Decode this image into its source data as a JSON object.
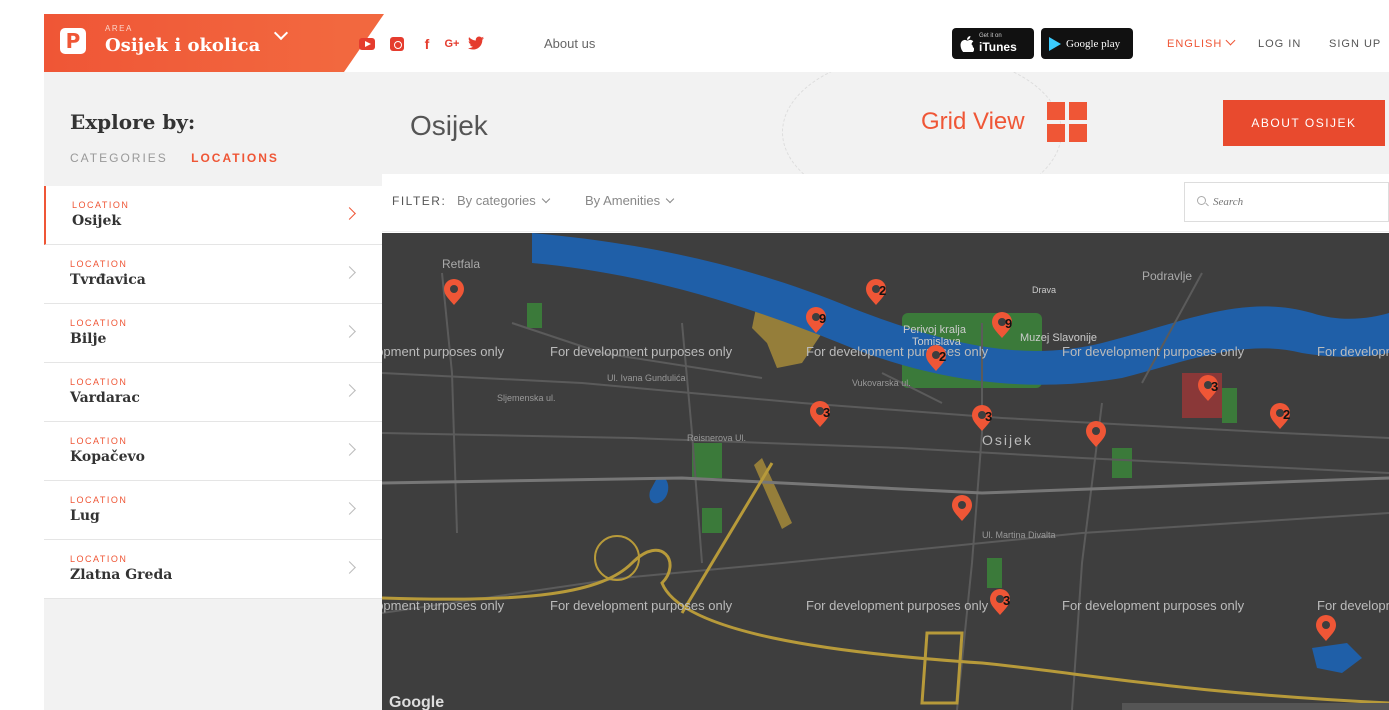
{
  "topbar": {
    "area_label": "AREA",
    "area_name": "Osijek i okolica",
    "about_us": "About us",
    "itunes_small": "Get it on",
    "itunes_label": "iTunes",
    "googleplay_label": "Google play",
    "language": "ENGLISH",
    "login": "LOG IN",
    "signup": "SIGN UP",
    "social_icons": [
      "youtube-icon",
      "instagram-icon",
      "facebook-icon",
      "google-plus-icon",
      "twitter-icon"
    ]
  },
  "sidebar": {
    "heading": "Explore by:",
    "tab_categories": "CATEGORIES",
    "tab_locations": "LOCATIONS",
    "item_label": "LOCATION",
    "items": [
      {
        "label": "LOCATION",
        "name": "Osijek"
      },
      {
        "label": "LOCATION",
        "name": "Tvrđavica"
      },
      {
        "label": "LOCATION",
        "name": "Bilje"
      },
      {
        "label": "LOCATION",
        "name": "Vardarac"
      },
      {
        "label": "LOCATION",
        "name": "Kopačevo"
      },
      {
        "label": "LOCATION",
        "name": "Lug"
      },
      {
        "label": "LOCATION",
        "name": "Zlatna Greda"
      }
    ]
  },
  "header": {
    "title": "Osijek",
    "grid_view": "Grid View",
    "about_button": "ABOUT OSIJEK"
  },
  "filter": {
    "label": "FILTER:",
    "by_categories": "By categories",
    "by_amenities": "By Amenities",
    "search_placeholder": "Search"
  },
  "map": {
    "google_logo": "Google",
    "watermark": "For development purposes only",
    "labels": {
      "retfala": "Retfala",
      "podravlje": "Podravlje",
      "perivoj": "Perivoj kralja",
      "tomislava": "Tomislava",
      "muzej": "Muzej Slavonije",
      "osijek": "Osijek",
      "drava": "Drava",
      "gundulica": "Ul. Ivana Gundulića",
      "vukovarska": "Vukovarska ul.",
      "martina": "Ul. Martina Divalta",
      "reisnerova": "Reisnerova Ul.",
      "sljemenska": "Sljemenska ul."
    },
    "markers": [
      {
        "count": "",
        "color": "#ef5636"
      },
      {
        "count": "2",
        "color": "#ef5636"
      },
      {
        "count": "9",
        "color": "#ef5636"
      },
      {
        "count": "9",
        "color": "#ef5636"
      },
      {
        "count": "2",
        "color": "#ef5636"
      },
      {
        "count": "3",
        "color": "#ef5636"
      },
      {
        "count": "3",
        "color": "#ef5636"
      },
      {
        "count": "",
        "color": "#ef5636"
      },
      {
        "count": "3",
        "color": "#ef5636"
      },
      {
        "count": "2",
        "color": "#ef5636"
      },
      {
        "count": "",
        "color": "#ef5636"
      },
      {
        "count": "3",
        "color": "#ef5636"
      },
      {
        "count": "",
        "color": "#ef5636"
      }
    ]
  },
  "colors": {
    "accent": "#ef5636",
    "map_bg": "#3e3e3e",
    "river": "#1f5fa8",
    "park": "#3b7a3a"
  }
}
